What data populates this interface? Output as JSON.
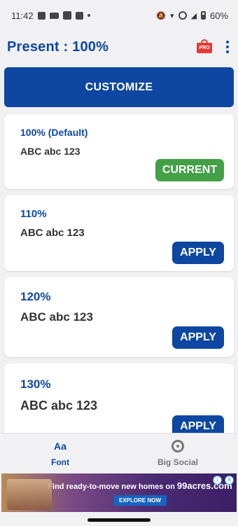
{
  "status": {
    "time": "11:42",
    "battery": "60%"
  },
  "header": {
    "title": "Present : 100%",
    "pro_icon": "pro-bag-icon",
    "pro_label": "PRO"
  },
  "customize_label": "CUSTOMIZE",
  "options": [
    {
      "percent": "100% (Default)",
      "sample": "ABC abc 123",
      "button": "CURRENT"
    },
    {
      "percent": "110%",
      "sample": "ABC abc 123",
      "button": "APPLY"
    },
    {
      "percent": "120%",
      "sample": "ABC abc 123",
      "button": "APPLY"
    },
    {
      "percent": "130%",
      "sample": "ABC abc 123",
      "button": "APPLY"
    }
  ],
  "nav": {
    "font": {
      "icon_text": "Aa",
      "label": "Font"
    },
    "big_social": {
      "label": "Big Social"
    }
  },
  "ad": {
    "text": "Find ready-to-move new homes on",
    "brand": "99acres.com",
    "button": "EXPLORE NOW"
  },
  "colors": {
    "primary": "#0d47a1",
    "current": "#43a047",
    "background": "#f1f1f4"
  }
}
